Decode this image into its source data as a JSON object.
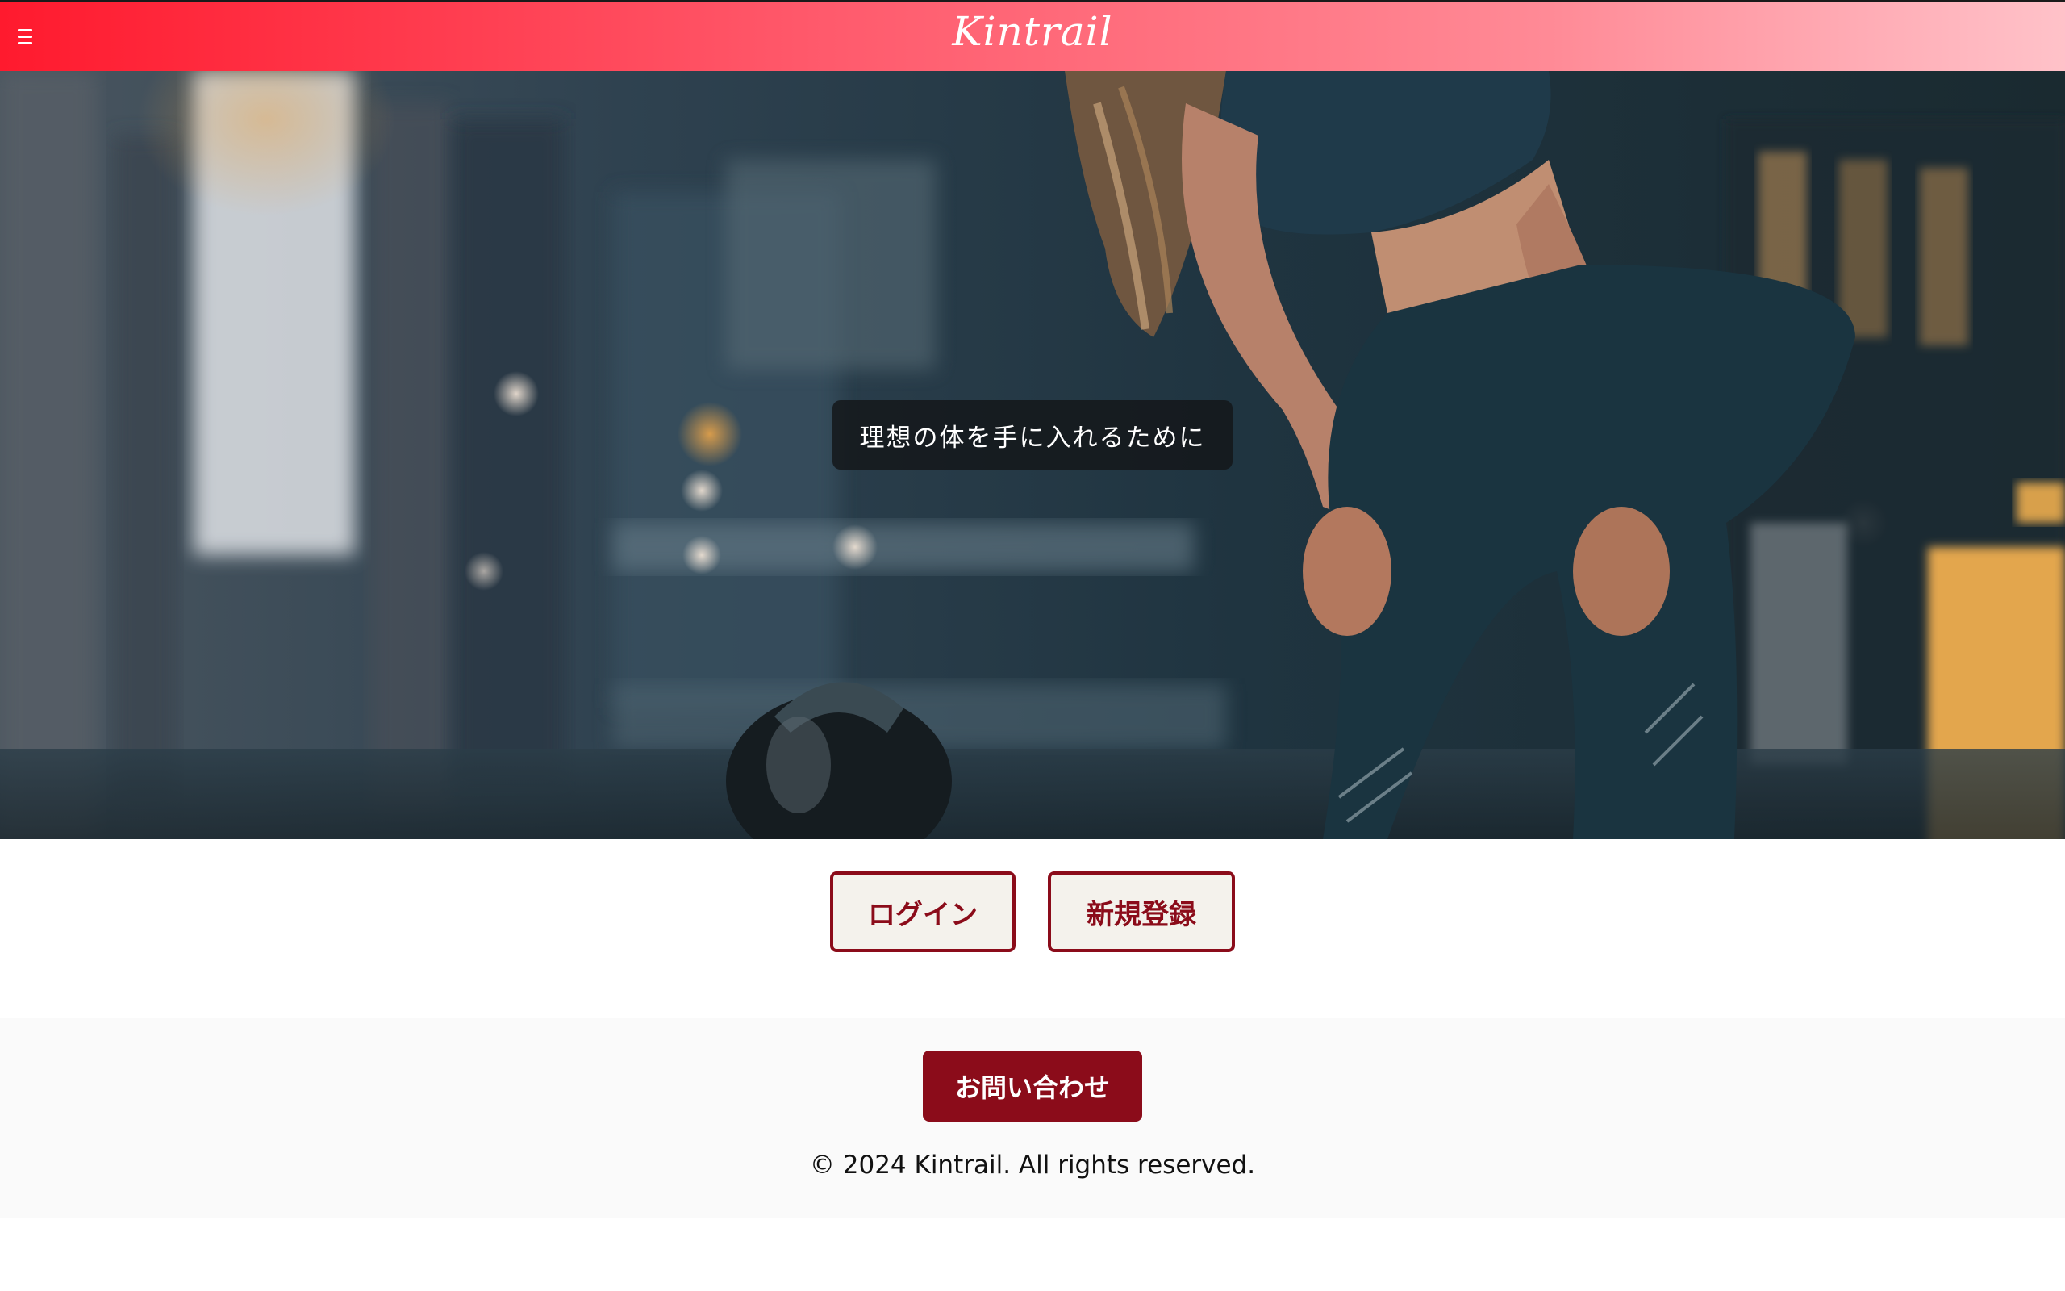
{
  "header": {
    "brand": "Kintrail",
    "menu_icon": "hamburger-icon",
    "gradient": [
      "#ff1a2e",
      "#ffc2c9"
    ]
  },
  "hero": {
    "tagline": "理想の体を手に入れるために",
    "image": "gym-woman-resting-photo"
  },
  "auth": {
    "login_label": "ログイン",
    "signup_label": "新規登録"
  },
  "footer": {
    "contact_label": "お問い合わせ",
    "copyright": "© 2024 Kintrail. All rights reserved."
  },
  "colors": {
    "accent": "#8b0c1a",
    "button_bg": "#f4f2ec",
    "footer_bg": "#fafafa"
  }
}
